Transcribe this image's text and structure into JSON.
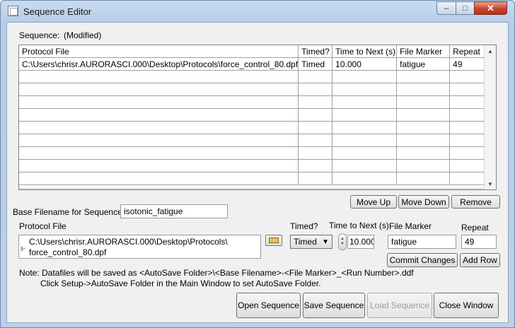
{
  "window": {
    "title": "Sequence Editor",
    "controls": {
      "minimize": "–",
      "maximize": "□",
      "close": "✕"
    }
  },
  "sequence": {
    "label": "Sequence:",
    "status": "(Modified)"
  },
  "table": {
    "columns": [
      "Protocol File",
      "Timed?",
      "Time to Next (s)",
      "File Marker",
      "Repeat"
    ],
    "rows": [
      [
        "C:\\Users\\chrisr.AURORASCI.000\\Desktop\\Protocols\\force_control_80.dpf",
        "Timed",
        "10.000",
        "fatigue",
        "49"
      ]
    ],
    "empty_rows": 9
  },
  "buttons": {
    "move_up": "Move Up",
    "move_down": "Move Down",
    "remove": "Remove",
    "commit_changes": "Commit Changes",
    "add_row": "Add Row",
    "open_sequence": "Open Sequence",
    "save_sequence": "Save Sequence",
    "load_sequence": "Load Sequence",
    "close_window": "Close Window"
  },
  "base_filename": {
    "label": "Base Filename for Sequence",
    "value": "isotonic_fatigue"
  },
  "protocol_file": {
    "label": "Protocol File",
    "line1": "C:\\Users\\chrisr.AURORASCI.000\\Desktop\\Protocols\\",
    "line2": "force_control_80.dpf"
  },
  "timed": {
    "label": "Timed?",
    "value": "Timed"
  },
  "time_to_next": {
    "label": "Time to Next (s)",
    "value": "10.000"
  },
  "file_marker": {
    "label": "File Marker",
    "value": "fatigue"
  },
  "repeat": {
    "label": "Repeat",
    "value": "49"
  },
  "note": {
    "line1": "Note: Datafiles will be saved as <AutoSave Folder>\\<Base Filename>-<File Marker>_<Run Number>.ddf",
    "line2": "Click Setup->AutoSave Folder in the Main Window to set AutoSave Folder."
  },
  "icons": {
    "app": "sequence-app-icon",
    "folder": "folder-icon",
    "dropdown": "chevron-down-icon",
    "spinner": "spinner-icon"
  }
}
